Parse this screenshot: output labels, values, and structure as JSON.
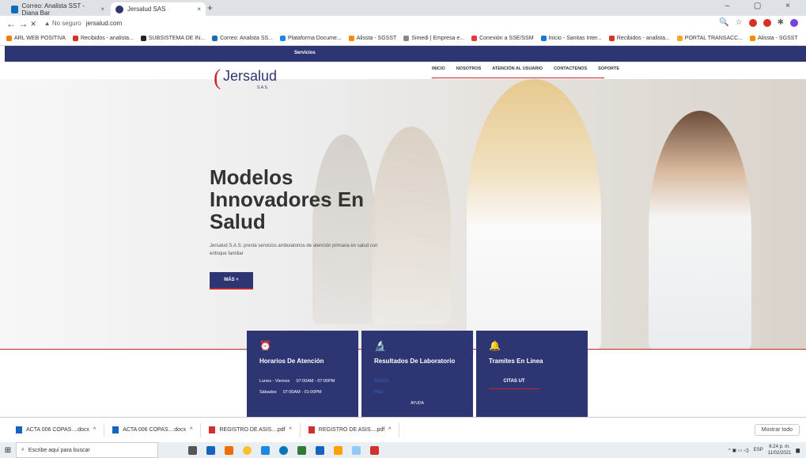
{
  "browser": {
    "tabs": [
      {
        "label": "Correo: Analista SST - Diana Bar",
        "close": "×"
      },
      {
        "label": "Jersalud SAS",
        "close": "×"
      }
    ],
    "new_tab": "+",
    "nav": "← → ×",
    "security": "▲ No seguro",
    "url": "jersalud.com",
    "bookmarks": [
      "ARL WEB POSITIVA",
      "Recibidos - analista...",
      "SUBSISTEMA DE IN...",
      "Correo: Analista SS...",
      "Plataforma Docume...",
      "Alissta - SGSST",
      "Simedi | Empresa e...",
      "Conexión a SSE/SSM",
      "Inicio - Sanitas Inter...",
      "Recibidos - analista...",
      "PORTAL TRANSACC...",
      "Alissta - SGSST"
    ]
  },
  "site": {
    "topbar": "Servicios",
    "logo": {
      "name": "Jersalud",
      "sub": "S.A.S."
    },
    "menu": [
      "INICIO",
      "NOSOTROS",
      "ATENCIÓN AL USUARIO",
      "CONTACTENOS",
      "SOPORTE"
    ],
    "hero": {
      "title_lines": [
        "Modelos",
        "Innovadores En",
        "Salud"
      ],
      "desc": "Jersalud S.A.S. presta servicios ambulatorios de atención primaria en salud con enfoque familiar",
      "button": "MÁS +"
    },
    "cards": [
      {
        "title": "Horarios De Atención",
        "rows": [
          [
            "Lunes - Viernes",
            "07:00AM - 07:00PM"
          ],
          [
            "Sábados",
            "07:00AM - 01:00PM"
          ]
        ]
      },
      {
        "title": "Resultados De Laboratorio",
        "links": [
          "Envíos",
          "Más"
        ],
        "footer": "AYUDA"
      },
      {
        "title": "Tramites En Linea",
        "cta": "CITAS UT"
      }
    ]
  },
  "downloads": {
    "items": [
      "ACTA 006 COPAS....docx",
      "ACTA 006 COPAS....docx",
      "REGISTRO DE ASIS....pdf",
      "REGISTRO DE ASIS....pdf"
    ],
    "show_all": "Mostrar todo"
  },
  "taskbar": {
    "search_placeholder": "Escribe aquí para buscar",
    "lang": "ESP",
    "time": "6:24 p. m.",
    "date": "11/02/2021"
  }
}
